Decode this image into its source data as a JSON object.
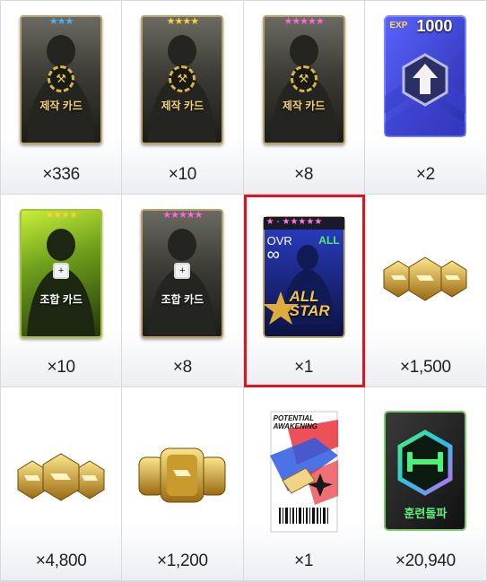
{
  "items": [
    {
      "count": "×336",
      "kind": "craft-card",
      "stars": "★★★",
      "star_color": "#3fb4ff",
      "label": "제작 카드"
    },
    {
      "count": "×10",
      "kind": "craft-card",
      "stars": "★★★★",
      "star_color": "#f7d23a",
      "label": "제작 카드"
    },
    {
      "count": "×8",
      "kind": "craft-card",
      "stars": "★★★★★",
      "star_color": "#ff66d9",
      "label": "제작 카드"
    },
    {
      "count": "×2",
      "kind": "exp-card",
      "exp_label": "EXP",
      "exp_value": "1000"
    },
    {
      "count": "×10",
      "kind": "combine-card",
      "stars": "★★★★",
      "star_color": "#f7d23a",
      "label": "조합 카드"
    },
    {
      "count": "×8",
      "kind": "combine-card",
      "stars": "★★★★★",
      "star_color": "#ff66d9",
      "label": "조합 카드"
    },
    {
      "count": "×1",
      "kind": "allstar-card",
      "stars": "★ - ★★★★★",
      "ovr": "OVR",
      "all": "ALL",
      "infinity": "∞",
      "logo_line1": "ALL",
      "logo_line2": "STAR"
    },
    {
      "count": "×1,500",
      "kind": "gold-gems-3"
    },
    {
      "count": "×4,800",
      "kind": "gold-gems-3b"
    },
    {
      "count": "×1,200",
      "kind": "gold-coins-3"
    },
    {
      "count": "×1",
      "kind": "potential-ticket",
      "title_line1": "POTENTIAL",
      "title_line2": "AWAKENING"
    },
    {
      "count": "×20,940",
      "kind": "training-card",
      "label": "훈련돌파"
    }
  ],
  "selected_index": 6,
  "colors": {
    "selection": "#e0141e",
    "border": "#d6d9de",
    "gold": "#d9b44a"
  }
}
